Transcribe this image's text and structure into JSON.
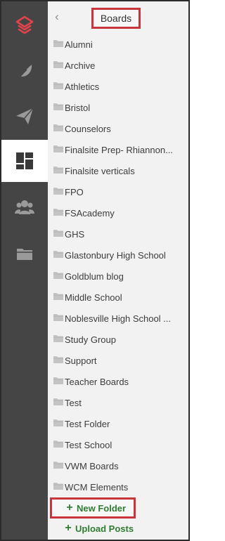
{
  "panel": {
    "back_icon": "chevron-left-icon",
    "title": "Boards"
  },
  "rail": {
    "items": [
      {
        "icon": "logo-icon",
        "active": false
      },
      {
        "icon": "feather-icon",
        "active": false
      },
      {
        "icon": "paper-plane-icon",
        "active": false
      },
      {
        "icon": "dashboard-icon",
        "active": true
      },
      {
        "icon": "users-icon",
        "active": false
      },
      {
        "icon": "folder-icon",
        "active": false
      }
    ]
  },
  "folders": [
    {
      "label": "Alumni"
    },
    {
      "label": "Archive"
    },
    {
      "label": "Athletics"
    },
    {
      "label": "Bristol"
    },
    {
      "label": "Counselors"
    },
    {
      "label": "Finalsite Prep- Rhiannon..."
    },
    {
      "label": "Finalsite verticals"
    },
    {
      "label": "FPO"
    },
    {
      "label": "FSAcademy"
    },
    {
      "label": "GHS"
    },
    {
      "label": "Glastonbury High School"
    },
    {
      "label": "Goldblum blog"
    },
    {
      "label": "Middle School"
    },
    {
      "label": "Noblesville High School ..."
    },
    {
      "label": "Study Group"
    },
    {
      "label": "Support"
    },
    {
      "label": "Teacher Boards"
    },
    {
      "label": "Test"
    },
    {
      "label": "Test Folder"
    },
    {
      "label": "Test School"
    },
    {
      "label": "VWM Boards"
    },
    {
      "label": "WCM Elements"
    }
  ],
  "actions": {
    "new_folder": "New Folder",
    "upload_posts": "Upload Posts",
    "plus_glyph": "+"
  },
  "colors": {
    "rail_bg": "#454545",
    "brand_red": "#e1434a",
    "highlight_red": "#c8353a",
    "action_green": "#2e7d32",
    "panel_bg": "#f2f2f2"
  }
}
